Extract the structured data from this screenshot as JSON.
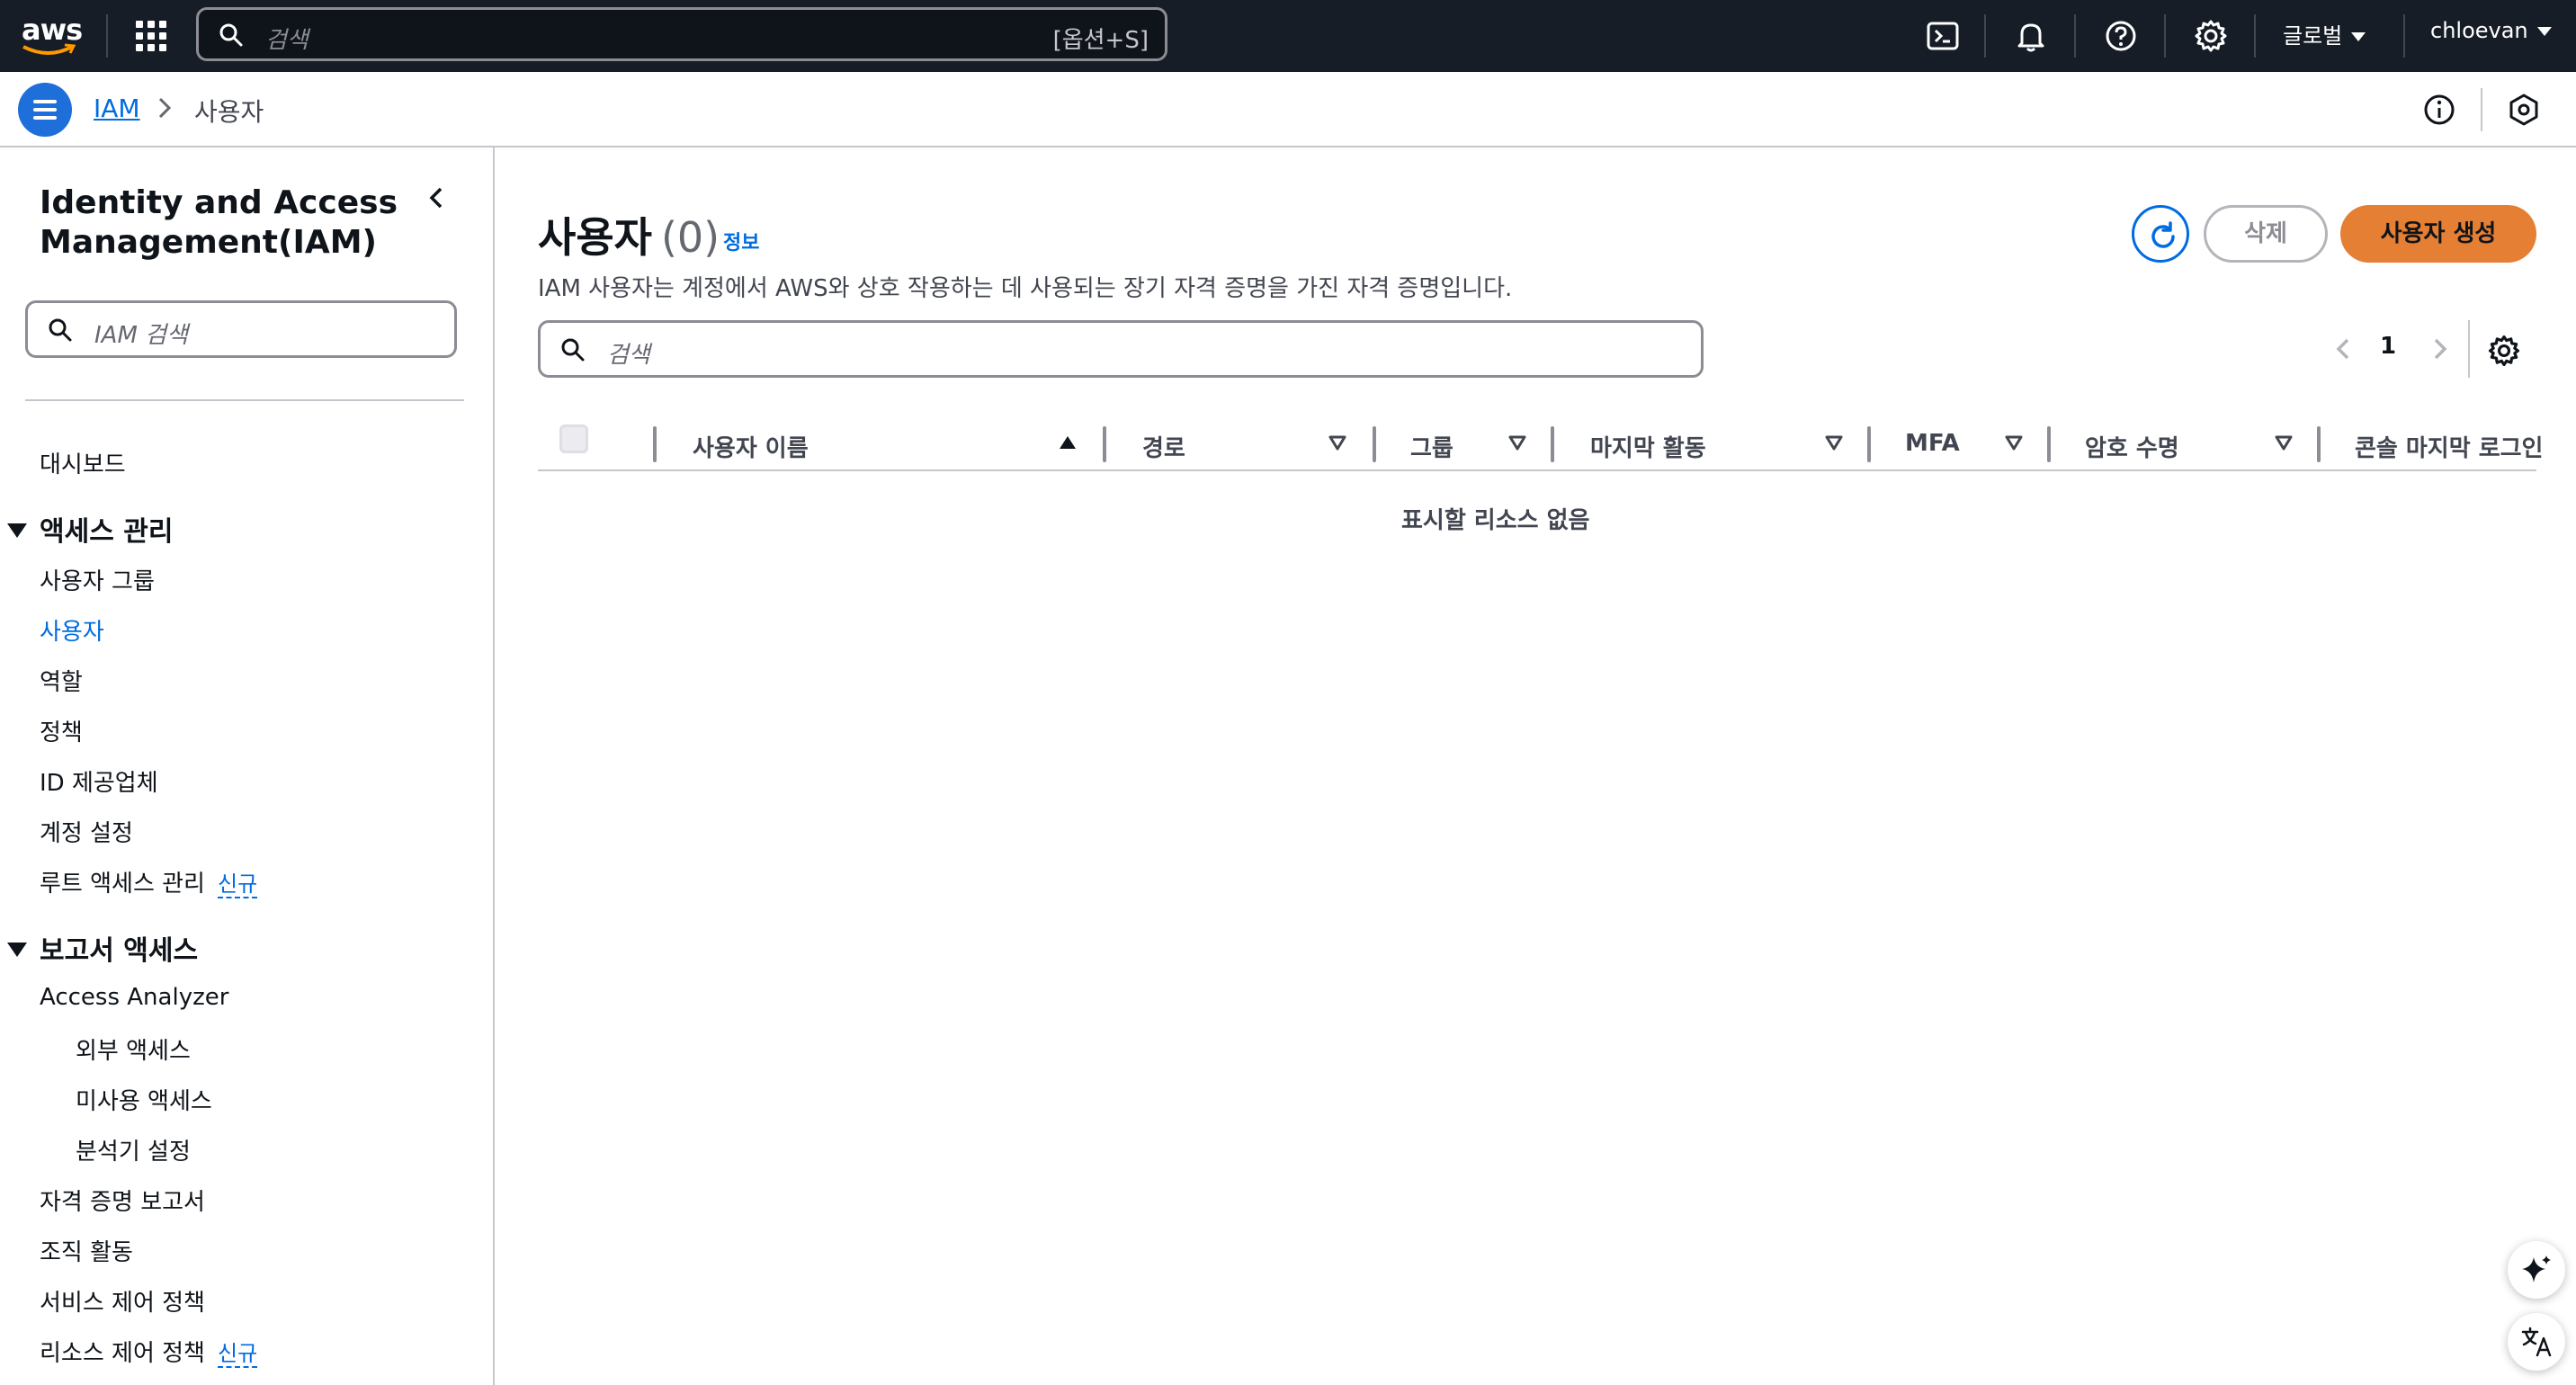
{
  "topnav": {
    "logo_text": "aws",
    "search_placeholder": "검색",
    "search_shortcut": "[옵션+S]",
    "region_label": "글로벌",
    "user_label": "chloevan"
  },
  "breadcrumb": {
    "root": "IAM",
    "current": "사용자"
  },
  "sidebar": {
    "title": "Identity and Access Management(IAM)",
    "search_placeholder": "IAM 검색",
    "dashboard": "대시보드",
    "section_access": "액세스 관리",
    "access_items": [
      "사용자 그룹",
      "사용자",
      "역할",
      "정책",
      "ID 제공업체",
      "계정 설정",
      "루트 액세스 관리"
    ],
    "new_badge": "신규",
    "section_reports": "보고서 액세스",
    "report_items": [
      "Access Analyzer",
      "외부 액세스",
      "미사용 액세스",
      "분석기 설정",
      "자격 증명 보고서",
      "조직 활동",
      "서비스 제어 정책",
      "리소스 제어 정책"
    ]
  },
  "main": {
    "title": "사용자",
    "count": "(0)",
    "info": "정보",
    "description": "IAM 사용자는 계정에서 AWS와 상호 작용하는 데 사용되는 장기 자격 증명을 가진 자격 증명입니다.",
    "delete_label": "삭제",
    "create_label": "사용자 생성",
    "search_placeholder": "검색",
    "page_number": "1",
    "columns": [
      "사용자 이름",
      "경로",
      "그룹",
      "마지막 활동",
      "MFA",
      "암호 수명",
      "콘솔 마지막 로그인"
    ],
    "empty_message": "표시할 리소스 없음"
  },
  "colors": {
    "topnav_bg": "#161d26",
    "link": "#006ce0",
    "primary_button": "#e57f34",
    "menu_button": "#1e6fd9"
  },
  "icons": [
    "aws-logo",
    "apps-grid-icon",
    "search-icon",
    "cloudshell-icon",
    "bell-icon",
    "help-icon",
    "gear-icon",
    "hamburger-icon",
    "info-icon",
    "hexagon-icon",
    "chevron-left-icon",
    "refresh-icon",
    "chevron-right-icon",
    "sort-asc-icon",
    "sort-desc-icon",
    "sparkle-icon",
    "translate-icon"
  ]
}
